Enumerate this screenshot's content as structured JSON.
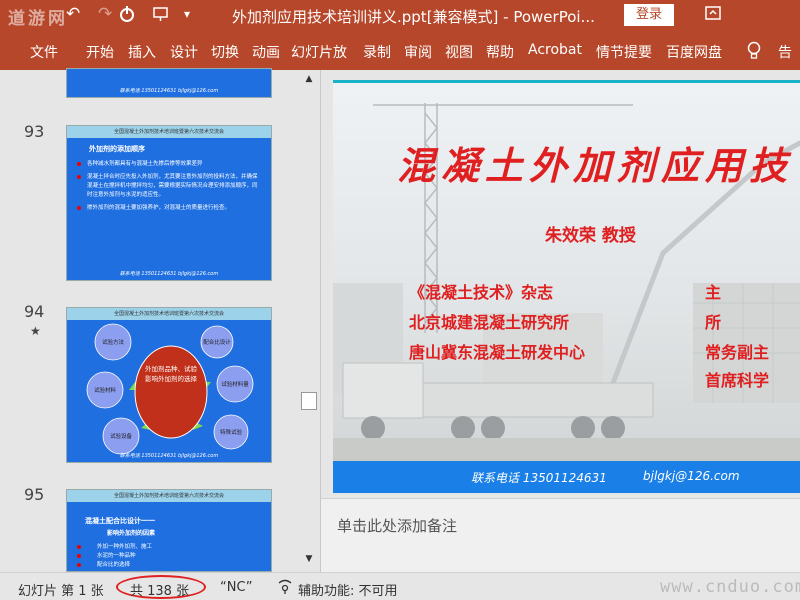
{
  "titlebar": {
    "watermark": "道游网",
    "title": "外加剂应用技术培训讲义.ppt[兼容模式] - PowerPoi...",
    "login": "登录"
  },
  "ribbon": {
    "tabs": [
      "文件",
      "开始",
      "插入",
      "设计",
      "切换",
      "动画",
      "幻灯片放",
      "录制",
      "审阅",
      "视图",
      "帮助",
      "Acrobat",
      "情节提要",
      "百度网盘"
    ],
    "tell_me": "告"
  },
  "thumbnails": {
    "slide93": {
      "number": "93",
      "header": "全国混凝土外加剂技术培训班暨第六次技术交流会",
      "title": "外加剂的添加顺序",
      "bullets": [
        "各种减水剂都具有与混凝土先掺后掺等效果差异",
        "混凝土拌合时应先投入外加剂，尤其要注意外加剂的投料方法，并确保混凝土在搅拌机中搅拌均匀，需要根据实际情况合理安排添加顺序，同时注意外加剂与水泥的适应性。",
        "掺外加剂的混凝土要加强养护，对混凝土的质量进行检查。"
      ],
      "footer": "联系电话 13501124631    bjlgkj@126.com"
    },
    "slide94": {
      "number": "94",
      "star": "★",
      "header": "全国混凝土外加剂技术培训班暨第六次技术交流会",
      "center": "外加剂品种、试验影响外加剂的选择",
      "nodes": [
        "试验方法",
        "配合比设计",
        "试验材料量",
        "试验材料",
        "特殊试验",
        "试验设备"
      ],
      "footer": "联系电话 13501124631    bjlgkj@126.com"
    },
    "slide95": {
      "number": "95",
      "header": "全国混凝土外加剂技术培训班暨第六次技术交流会",
      "title": "混凝土配合比设计一一",
      "subtitle": "影响外加剂的因素",
      "bullets": [
        "外加一种外加剂、施工",
        "水泥的一种品种",
        "配合比的选择"
      ]
    },
    "slide92": {
      "footer": "联系电话 13501124631    bjlgkj@126.com"
    }
  },
  "slide": {
    "title": "混凝土外加剂应用技",
    "author": "朱效荣 教授",
    "affiliations": [
      {
        "org": "《混凝土技术》杂志",
        "role": "主"
      },
      {
        "org": "北京城建混凝土研究所",
        "role": "所"
      },
      {
        "org": "唐山冀东混凝土研发中心",
        "role": "常务副主"
      },
      {
        "org": "",
        "role": "首席科学"
      }
    ],
    "footer_phone": "联系电话 13501124631",
    "footer_email": "bjlgkj@126.com"
  },
  "notes": {
    "placeholder": "单击此处添加备注"
  },
  "statusbar": {
    "slide_info": "幻灯片 第 1 张",
    "total": "共 138 张",
    "language": "“NC”",
    "accessibility": "辅助功能: 不可用",
    "watermark": "www.cnduo.com"
  },
  "colors": {
    "ribbon": "#b7472a",
    "slide_red": "#e02020",
    "thumb_blue": "#1f6fe0",
    "footer_blue": "#1a7fe6"
  }
}
